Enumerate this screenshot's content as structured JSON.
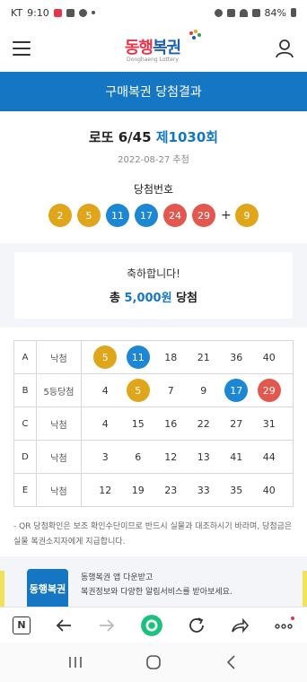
{
  "status": {
    "carrier": "KT",
    "time": "9:10",
    "battery": "84%"
  },
  "header": {
    "logo_text_a": "동행",
    "logo_text_b": "복권",
    "logo_sub": "Donghaeng Lottery"
  },
  "page_title": "구매복권 당첨결과",
  "draw": {
    "game": "로또 6/45",
    "round": "제1030회",
    "date": "2022-08-27 추첨",
    "winning_label": "당첨번호",
    "numbers": [
      {
        "n": "2",
        "color": "#e0a61b"
      },
      {
        "n": "5",
        "color": "#e0a61b"
      },
      {
        "n": "11",
        "color": "#1e87d4"
      },
      {
        "n": "17",
        "color": "#1e87d4"
      },
      {
        "n": "24",
        "color": "#e2584f"
      },
      {
        "n": "29",
        "color": "#e2584f"
      }
    ],
    "plus": "+",
    "bonus": {
      "n": "9",
      "color": "#e0a61b"
    }
  },
  "congrats": {
    "line1": "축하합니다!",
    "prefix": "총",
    "amount": "5,000원",
    "suffix": "당첨"
  },
  "tickets": [
    {
      "game": "A",
      "result": "낙첨",
      "nums": [
        {
          "n": "5",
          "hit": true,
          "color": "#e0a61b"
        },
        {
          "n": "11",
          "hit": true,
          "color": "#1e87d4"
        },
        {
          "n": "18",
          "hit": false
        },
        {
          "n": "21",
          "hit": false
        },
        {
          "n": "36",
          "hit": false
        },
        {
          "n": "40",
          "hit": false
        }
      ]
    },
    {
      "game": "B",
      "result": "5등당첨",
      "nums": [
        {
          "n": "4",
          "hit": false
        },
        {
          "n": "5",
          "hit": true,
          "color": "#e0a61b"
        },
        {
          "n": "7",
          "hit": false
        },
        {
          "n": "9",
          "hit": false
        },
        {
          "n": "17",
          "hit": true,
          "color": "#1e87d4"
        },
        {
          "n": "29",
          "hit": true,
          "color": "#e2584f"
        }
      ]
    },
    {
      "game": "C",
      "result": "낙첨",
      "nums": [
        {
          "n": "4",
          "hit": false
        },
        {
          "n": "15",
          "hit": false
        },
        {
          "n": "16",
          "hit": false
        },
        {
          "n": "22",
          "hit": false
        },
        {
          "n": "27",
          "hit": false
        },
        {
          "n": "31",
          "hit": false
        }
      ]
    },
    {
      "game": "D",
      "result": "낙첨",
      "nums": [
        {
          "n": "3",
          "hit": false
        },
        {
          "n": "6",
          "hit": false
        },
        {
          "n": "12",
          "hit": false
        },
        {
          "n": "13",
          "hit": false
        },
        {
          "n": "41",
          "hit": false
        },
        {
          "n": "44",
          "hit": false
        }
      ]
    },
    {
      "game": "E",
      "result": "낙첨",
      "nums": [
        {
          "n": "12",
          "hit": false
        },
        {
          "n": "19",
          "hit": false
        },
        {
          "n": "23",
          "hit": false
        },
        {
          "n": "33",
          "hit": false
        },
        {
          "n": "35",
          "hit": false
        },
        {
          "n": "40",
          "hit": false
        }
      ]
    }
  ],
  "notice": "- QR 당첨확인은 보조 확인수단이므로 반드시 실물과 대조하시기 바라며, 당첨금은 실물 복권소지자에게 지급합니다.",
  "promo": {
    "icon_text": "동행복권",
    "line1": "동행복권 앱 다운받고",
    "line2": "복권정보와 다양한 알림서비스를 받아보세요."
  },
  "browser": {
    "n_label": "N",
    "accent": "#19c37d"
  }
}
